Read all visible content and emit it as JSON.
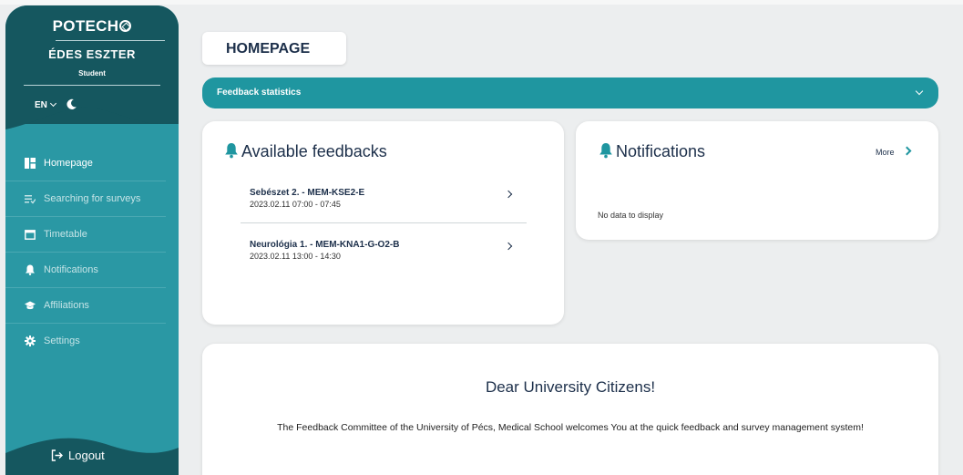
{
  "sidebar": {
    "brand": "POTECH",
    "user_name": "ÉDES ESZTER",
    "user_role": "Student",
    "language": "EN",
    "items": [
      {
        "label": "Homepage",
        "icon": "dashboard-icon",
        "active": true
      },
      {
        "label": "Searching for surveys",
        "icon": "search-list-icon",
        "active": false
      },
      {
        "label": "Timetable",
        "icon": "calendar-icon",
        "active": false
      },
      {
        "label": "Notifications",
        "icon": "bell-icon",
        "active": false
      },
      {
        "label": "Affiliations",
        "icon": "graduation-cap-icon",
        "active": false
      },
      {
        "label": "Settings",
        "icon": "gear-icon",
        "active": false
      }
    ],
    "logout": "Logout"
  },
  "main": {
    "page_title": "HOMEPAGE",
    "stats_label": "Feedback statistics",
    "feedbacks": {
      "title": "Available feedbacks",
      "items": [
        {
          "title": "Sebészet 2. - MEM-KSE2-E",
          "time": "2023.02.11 07:00 - 07:45"
        },
        {
          "title": "Neurológia 1. - MEM-KNA1-G-O2-B",
          "time": "2023.02.11 13:00 - 14:30"
        }
      ]
    },
    "notifications": {
      "title": "Notifications",
      "more": "More",
      "empty": "No data to display"
    },
    "welcome": {
      "title": "Dear University Citizens!",
      "text": "The Feedback Committee of the University of Pécs, Medical School welcomes You at the quick feedback and survey management system!"
    }
  },
  "colors": {
    "sidebar_dark": "#15575f",
    "sidebar": "#2a98a4",
    "accent": "#1f96a0",
    "text_dark": "#1c2f4a"
  }
}
